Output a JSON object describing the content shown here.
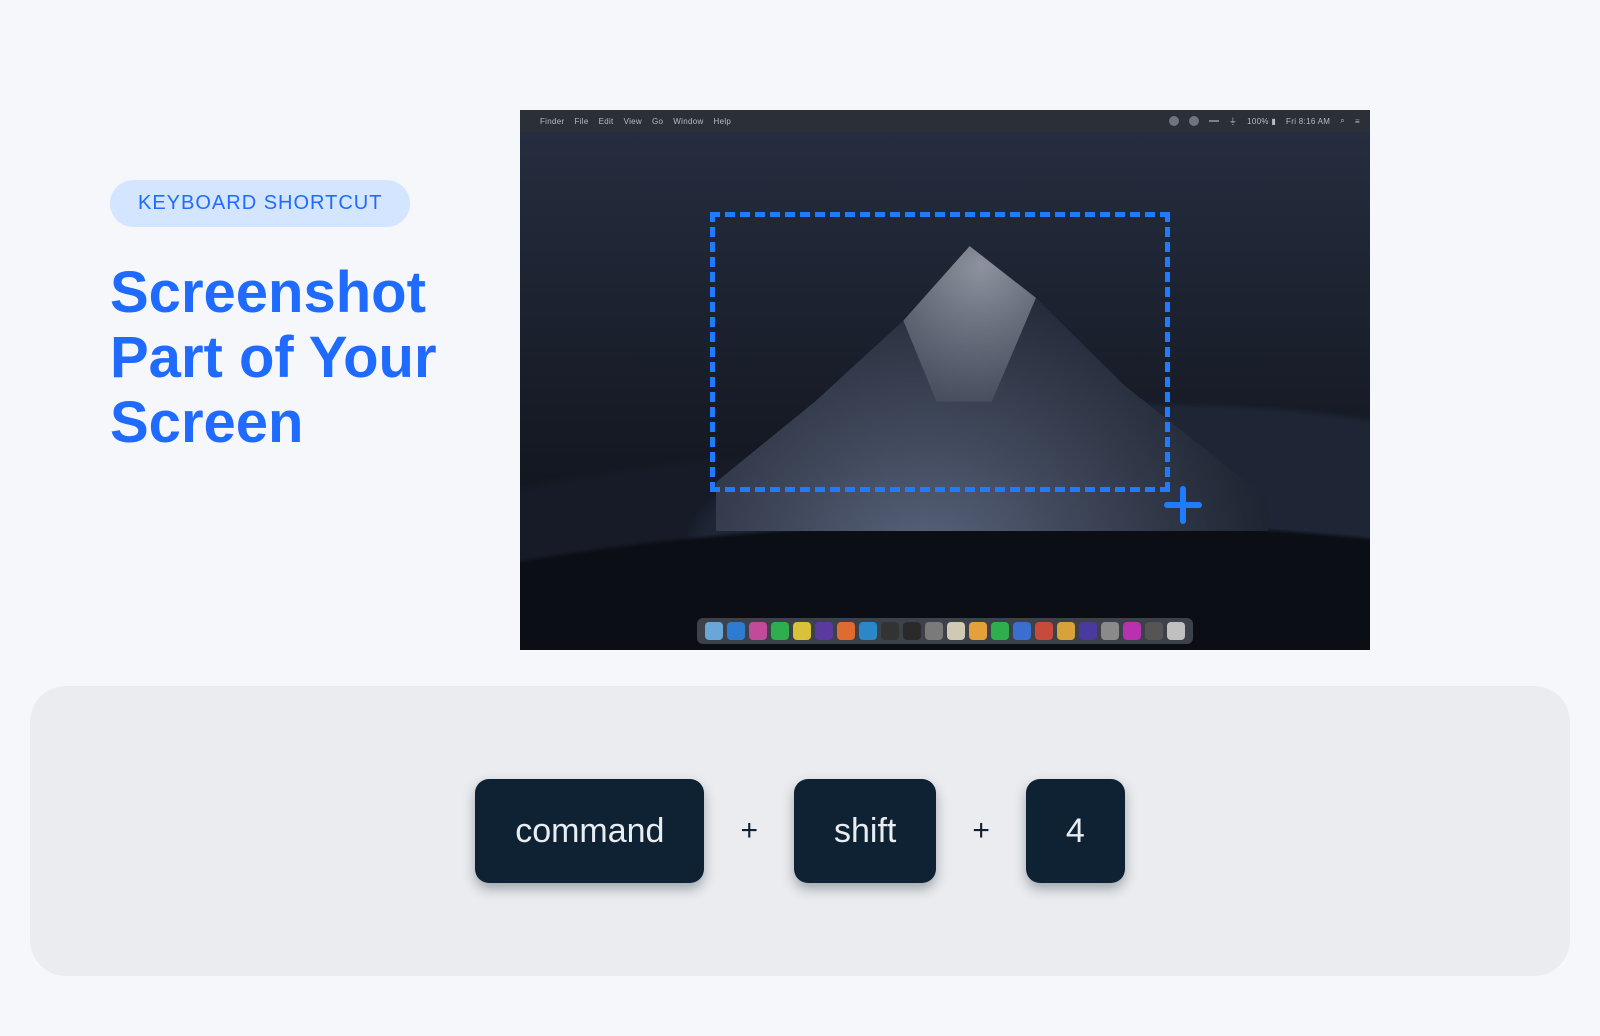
{
  "badge_label": "KEYBOARD SHORTCUT",
  "title_text": "Screenshot Part of Your Screen",
  "mac": {
    "menu_left": [
      "",
      "Finder",
      "File",
      "Edit",
      "View",
      "Go",
      "Window",
      "Help"
    ],
    "menu_right_time": "Fri 8:16 AM"
  },
  "shortcut": {
    "keys": [
      "command",
      "shift",
      "4"
    ],
    "separator": "+"
  },
  "dock_colors": [
    "#6aa6d8",
    "#2e7bd1",
    "#c24a9a",
    "#2fae4e",
    "#d8c23a",
    "#5b3aa0",
    "#e06b2e",
    "#2c87c9",
    "#333333",
    "#2a2a2a",
    "#7a7a7a",
    "#d0c9b4",
    "#e4a13a",
    "#2fae4e",
    "#3a6fd1",
    "#c74a3a",
    "#d8a23a",
    "#4a3aa0",
    "#8a8a8a",
    "#b930b0",
    "#555555",
    "#c0c0c0"
  ]
}
